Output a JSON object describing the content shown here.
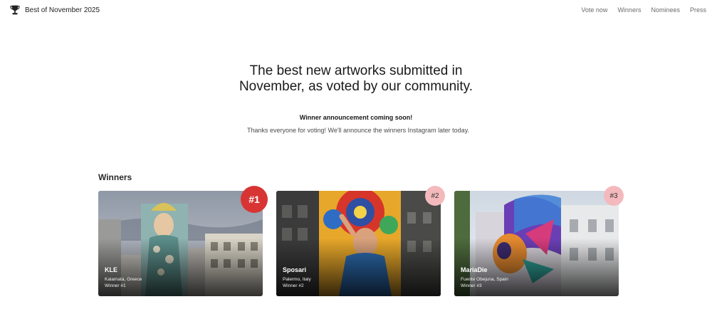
{
  "header": {
    "icon": "trophy-icon",
    "title": "Best of November 2025",
    "nav": [
      {
        "label": "Vote now"
      },
      {
        "label": "Winners"
      },
      {
        "label": "Nominees"
      },
      {
        "label": "Press"
      }
    ]
  },
  "hero": {
    "title_line1": "The best new artworks submitted in",
    "title_line2": "November, as voted by our community."
  },
  "announcement": {
    "heading": "Winner announcement coming soon!",
    "text": "Thanks everyone for voting! We'll announce the winners Instagram later today."
  },
  "winners": {
    "heading": "Winners",
    "cards": [
      {
        "artist": "KLE",
        "location": "Kalamata, Greece",
        "rank_text": "Winner #1",
        "badge": "#1"
      },
      {
        "artist": "Sposari",
        "location": "Palermo, Italy",
        "rank_text": "Winner #2",
        "badge": "#2"
      },
      {
        "artist": "MariaDie",
        "location": "Fuente Obejuna, Spain",
        "rank_text": "Winner #3",
        "badge": "#3"
      }
    ]
  },
  "colors": {
    "badge_first": "#d83434",
    "badge_other": "#f4b9bd"
  }
}
